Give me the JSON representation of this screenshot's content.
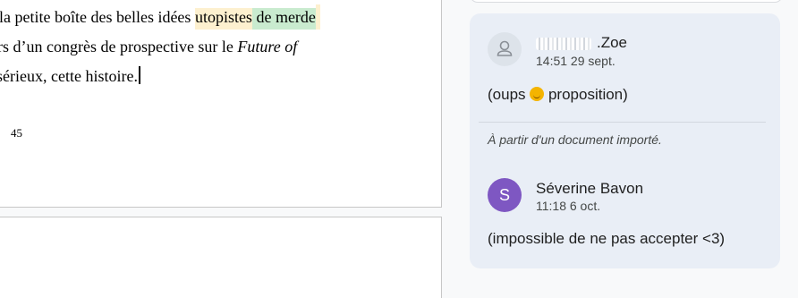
{
  "document": {
    "line1_prefix": "la petite boîte des belles idées ",
    "line1_highlight_yellow": "utopistes",
    "line1_highlight_green": " de merde",
    "line2_prefix": "rs d’un congrès de prospective sur le ",
    "line2_italic": "Future of",
    "line3": "sérieux, cette histoire.",
    "page_number": "45"
  },
  "comments": {
    "first": {
      "author": ".Zoe",
      "time": "14:51 29 sept.",
      "text_before": "(oups ",
      "emoji": "relieved-face-icon",
      "text_after": " proposition)"
    },
    "imported_note": "À partir d'un document importé.",
    "second": {
      "avatar_letter": "S",
      "author": "Séverine Bavon",
      "time": "11:18 6 oct.",
      "text": "(impossible de ne pas accepter <3)"
    }
  },
  "colors": {
    "highlight_yellow": "#fdf0cf",
    "highlight_green": "#c9ebcf",
    "card_bg": "#e9eef6",
    "avatar_purple": "#7e57c2"
  }
}
